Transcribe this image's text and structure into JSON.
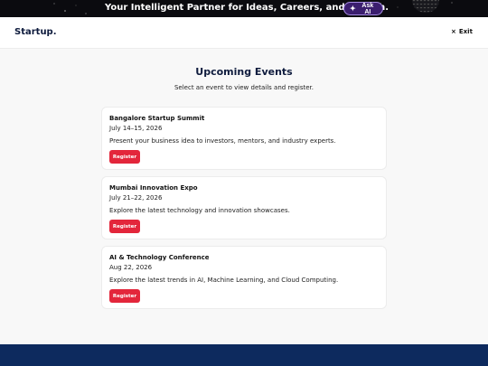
{
  "banner": {
    "text": "Your Intelligent Partner for Ideas, Careers, and Growth.",
    "ask_ai_label": "Ask AI"
  },
  "header": {
    "logo": "Startup",
    "logo_dot": ".",
    "exit_label": "Exit"
  },
  "main": {
    "title": "Upcoming Events",
    "subtitle": "Select an event to view details and register."
  },
  "events": [
    {
      "name": "Bangalore Startup Summit",
      "date": "July 14–15, 2026",
      "description": "Present your business idea to investors, mentors, and industry experts.",
      "button": "Register"
    },
    {
      "name": "Mumbai Innovation Expo",
      "date": "July 21–22, 2026",
      "description": "Explore the latest technology and innovation showcases.",
      "button": "Register"
    },
    {
      "name": "AI & Technology Conference",
      "date": "Aug 22, 2026",
      "description": "Explore the latest trends in AI, Machine Learning, and Cloud Computing.",
      "button": "Register"
    }
  ],
  "colors": {
    "brand_navy": "#0e1b3d",
    "register_red": "#e3263b",
    "footer_blue": "#0d2a5e"
  }
}
